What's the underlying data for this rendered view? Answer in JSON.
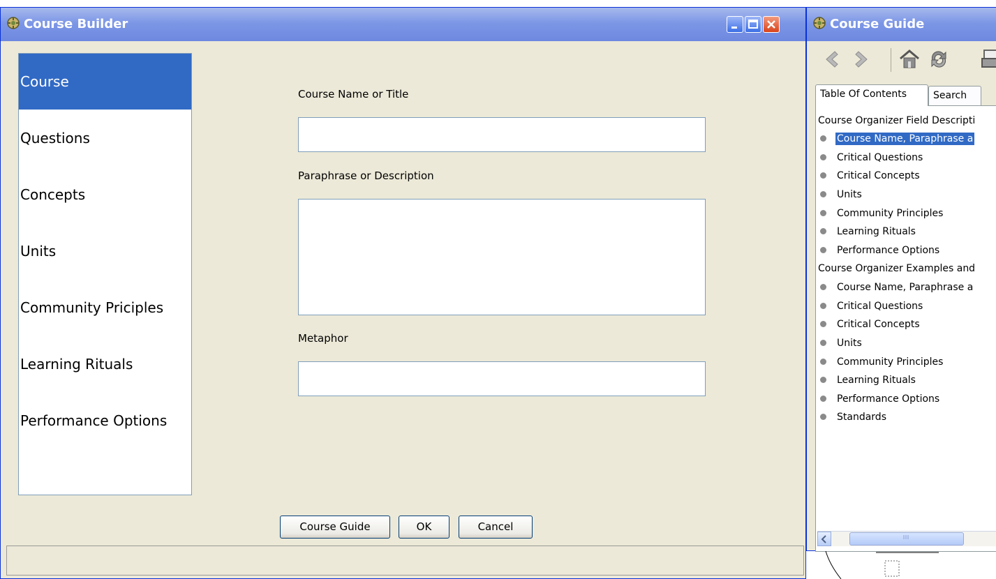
{
  "course_builder": {
    "title": "Course Builder",
    "nav_items": [
      {
        "label": "Course",
        "selected": true
      },
      {
        "label": "Questions",
        "selected": false
      },
      {
        "label": "Concepts",
        "selected": false
      },
      {
        "label": "Units",
        "selected": false
      },
      {
        "label": "Community Priciples",
        "selected": false
      },
      {
        "label": "Learning Rituals",
        "selected": false
      },
      {
        "label": "Performance Options",
        "selected": false
      }
    ],
    "fields": {
      "course_name_label": "Course Name or Title",
      "course_name_value": "",
      "paraphrase_label": "Paraphrase or Description",
      "paraphrase_value": "",
      "metaphor_label": "Metaphor",
      "metaphor_value": ""
    },
    "buttons": {
      "course_guide": "Course Guide",
      "ok": "OK",
      "cancel": "Cancel"
    },
    "status_text": ""
  },
  "course_guide": {
    "title": "Course Guide",
    "toolbar_icons": [
      "back-arrow-icon",
      "forward-arrow-icon",
      "home-icon",
      "refresh-icon",
      "print-icon"
    ],
    "tabs": [
      {
        "label": "Table Of Contents",
        "active": true
      },
      {
        "label": "Search",
        "active": false
      }
    ],
    "toc": [
      {
        "type": "header",
        "label": "Course Organizer Field Descripti"
      },
      {
        "type": "item",
        "label": "Course Name, Paraphrase a",
        "selected": true
      },
      {
        "type": "item",
        "label": "Critical Questions"
      },
      {
        "type": "item",
        "label": "Critical Concepts"
      },
      {
        "type": "item",
        "label": "Units"
      },
      {
        "type": "item",
        "label": "Community Principles"
      },
      {
        "type": "item",
        "label": "Learning Rituals"
      },
      {
        "type": "item",
        "label": "Performance Options"
      },
      {
        "type": "header",
        "label": "Course Organizer Examples and"
      },
      {
        "type": "item",
        "label": "Course Name, Paraphrase a"
      },
      {
        "type": "item",
        "label": "Critical Questions"
      },
      {
        "type": "item",
        "label": "Critical Concepts"
      },
      {
        "type": "item",
        "label": "Units"
      },
      {
        "type": "item",
        "label": "Community Principles"
      },
      {
        "type": "item",
        "label": "Learning Rituals"
      },
      {
        "type": "item",
        "label": "Performance Options"
      },
      {
        "type": "item",
        "label": "Standards"
      }
    ]
  },
  "colors": {
    "selection": "#316ac5",
    "title_bar": "#7d97e6",
    "window_bg": "#ece9d8"
  }
}
